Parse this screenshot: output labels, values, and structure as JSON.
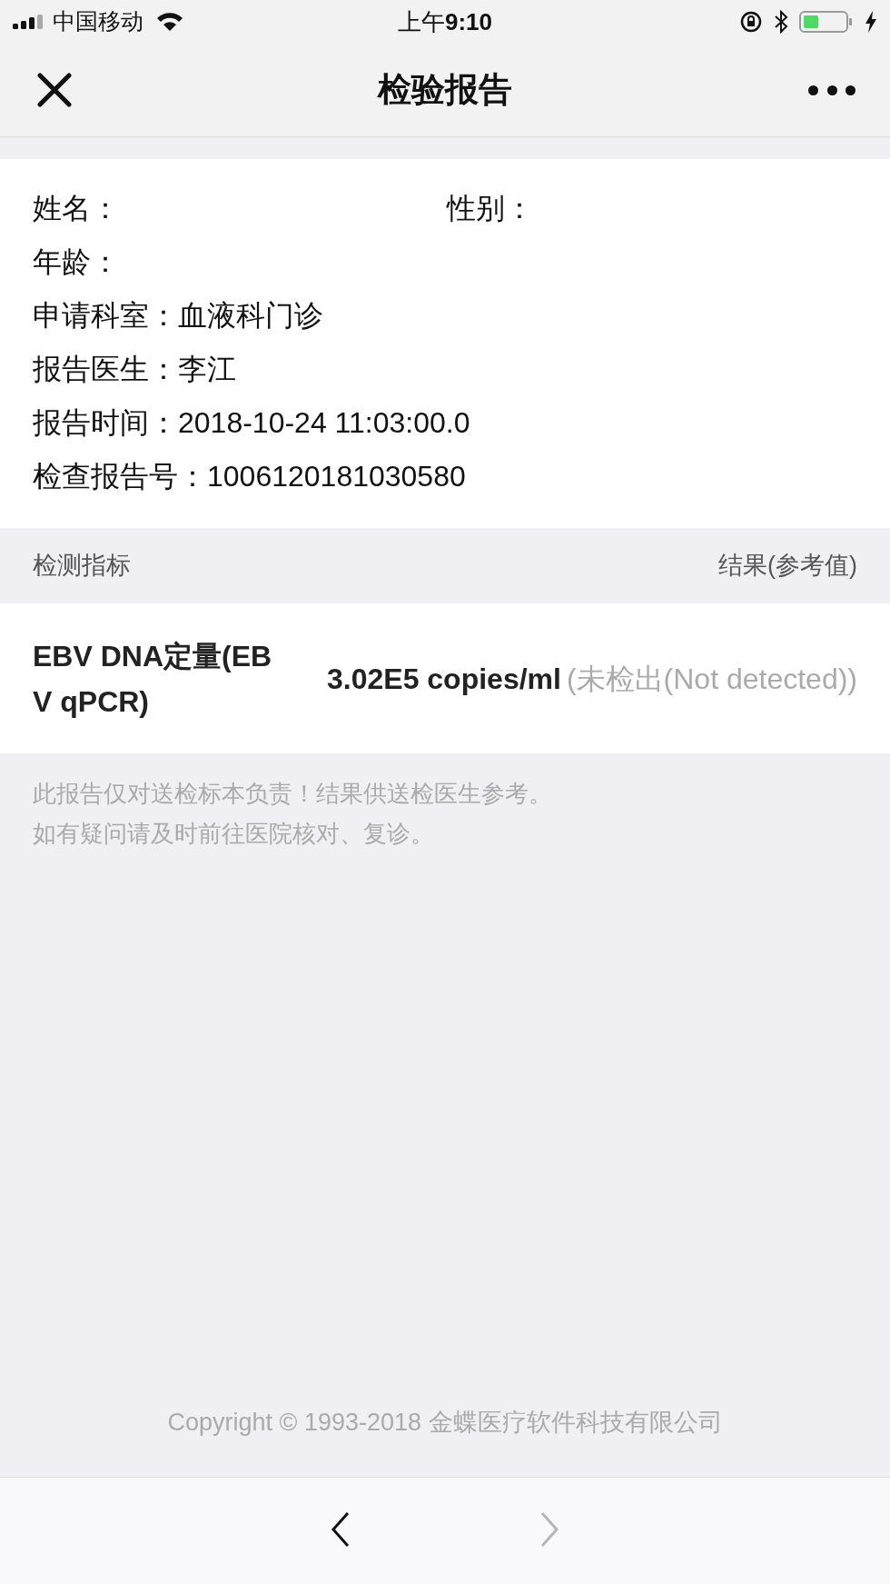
{
  "status_bar": {
    "carrier": "中国移动",
    "time_prefix": "上午",
    "time": "9:10"
  },
  "nav": {
    "title": "检验报告"
  },
  "patient_info": [
    [
      {
        "label": "姓名："
      },
      {
        "label": "性别："
      }
    ],
    [
      {
        "label": "年龄："
      }
    ],
    [
      {
        "label": "申请科室：",
        "value": "血液科门诊"
      }
    ],
    [
      {
        "label": "报告医生：",
        "value": "李江"
      }
    ],
    [
      {
        "label": "报告时间：",
        "value": "2018-10-24 11:03:00.0"
      }
    ],
    [
      {
        "label": "检查报告号：",
        "value": "1006120181030580"
      }
    ]
  ],
  "results_table": {
    "columns": [
      "检测指标",
      "结果(参考值)"
    ],
    "rows": [
      {
        "indicator": "EBV DNA定量(EBV qPCR)",
        "result": "3.02E5 copies/ml",
        "reference": "(未检出(Not detected))"
      }
    ]
  },
  "notes": [
    "此报告仅对送检标本负责！结果供送检医生参考。",
    "如有疑问请及时前往医院核对、复诊。"
  ],
  "copyright": "Copyright © 1993-2018 金蝶医疗软件科技有限公司",
  "toolbar": {
    "back": {
      "disabled": false
    },
    "forward": {
      "disabled": true
    }
  }
}
